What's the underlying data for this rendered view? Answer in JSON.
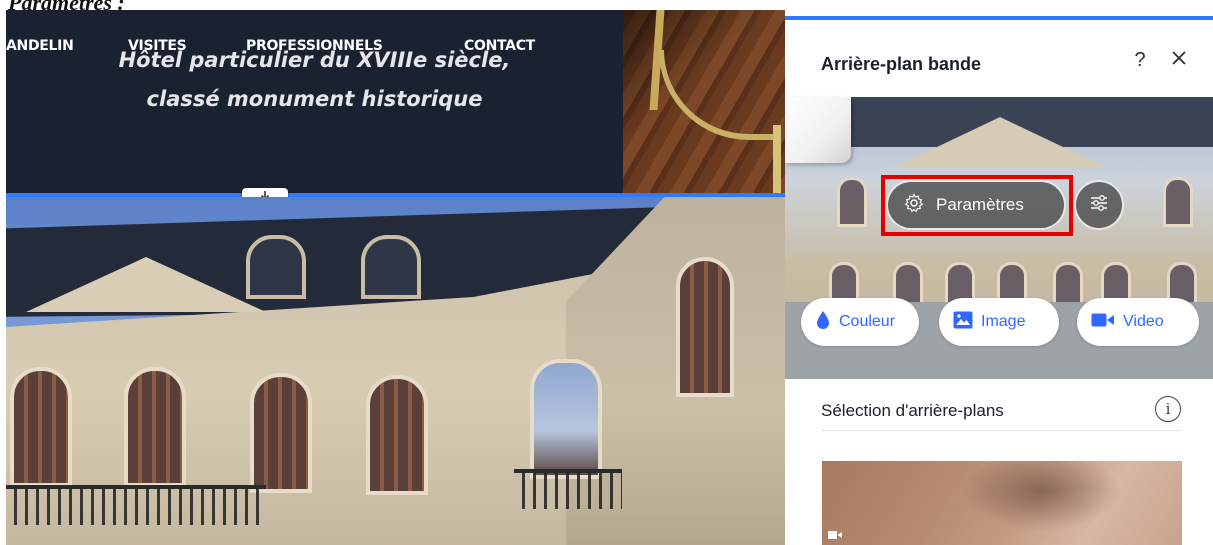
{
  "top_caption": "Paramètres :",
  "site": {
    "nav": [
      "ANDELIN",
      "VISITES",
      "PROFESSIONNELS",
      "CONTACT"
    ],
    "hero_line_1": "Hôtel particulier du XVIIIe siècle,",
    "hero_line_2": "classé monument historique"
  },
  "panel": {
    "title": "Arrière-plan bande",
    "help_label": "?",
    "settings_label": "Paramètres",
    "options": [
      {
        "label": "Couleur",
        "icon": "drop-icon"
      },
      {
        "label": "Image",
        "icon": "image-icon"
      },
      {
        "label": "Video",
        "icon": "video-icon"
      }
    ],
    "section_title": "Sélection d'arrière-plans",
    "info_label": "i"
  },
  "colors": {
    "accent": "#2f7bff",
    "highlight": "#e50000",
    "pill_text": "#2e68ff",
    "header_bg": "#1a2232"
  }
}
